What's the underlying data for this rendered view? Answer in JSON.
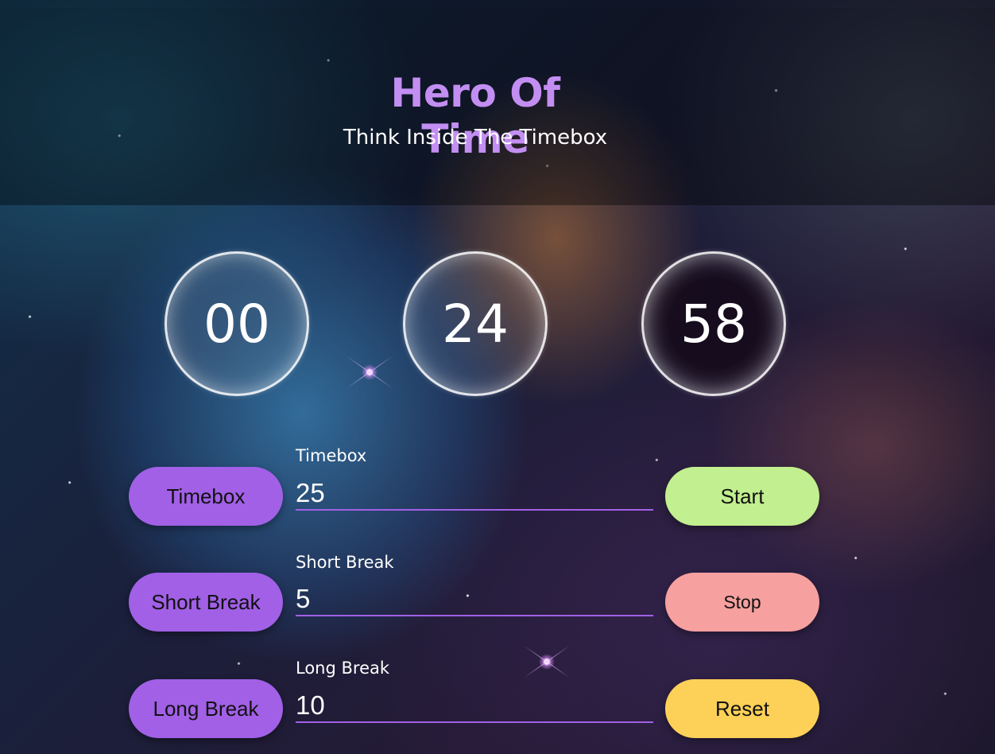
{
  "app": {
    "title": "Hero Of Time",
    "subtitle": "Think Inside The Timebox"
  },
  "timer": {
    "hours": "00",
    "minutes": "24",
    "seconds": "58"
  },
  "modes": {
    "timebox_label": "Timebox",
    "short_break_label": "Short Break",
    "long_break_label": "Long Break"
  },
  "fields": {
    "timebox": {
      "label": "Timebox",
      "value": "25"
    },
    "short_break": {
      "label": "Short Break",
      "value": "5"
    },
    "long_break": {
      "label": "Long Break",
      "value": "10"
    }
  },
  "controls": {
    "start_label": "Start",
    "stop_label": "Stop",
    "reset_label": "Reset"
  },
  "colors": {
    "accent_purple": "#a160e6",
    "title_purple": "#c38ef2",
    "start_green": "#c2ef8f",
    "stop_red": "#f7a0a0",
    "reset_yellow": "#fdd157"
  }
}
